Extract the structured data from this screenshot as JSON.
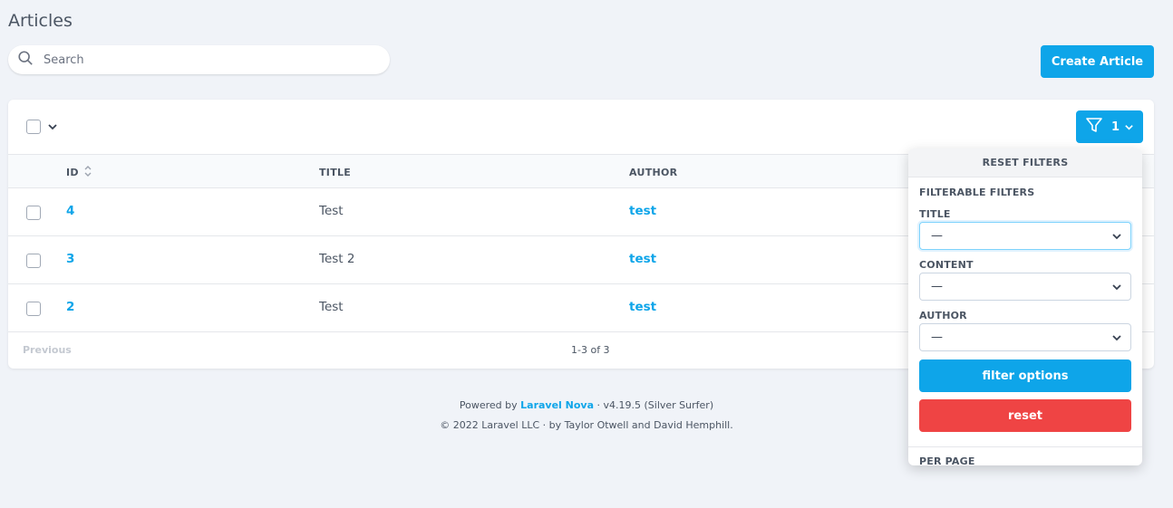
{
  "header": {
    "title": "Articles"
  },
  "search": {
    "placeholder": "Search"
  },
  "actions": {
    "create_label": "Create Article"
  },
  "toolbar": {
    "filter_count": "1"
  },
  "table": {
    "columns": {
      "id": "ID",
      "title": "TITLE",
      "author": "AUTHOR"
    },
    "rows": [
      {
        "id": "4",
        "title": "Test",
        "author": "test"
      },
      {
        "id": "3",
        "title": "Test 2",
        "author": "test"
      },
      {
        "id": "2",
        "title": "Test",
        "author": "test"
      }
    ]
  },
  "pagination": {
    "previous": "Previous",
    "range": "1-3 of 3"
  },
  "footer": {
    "powered_by": "Powered by",
    "brand": "Laravel Nova",
    "version": "· v4.19.5 (Silver Surfer)",
    "copyright": "© 2022 Laravel LLC · by Taylor Otwell and David Hemphill."
  },
  "filter_panel": {
    "reset_header": "RESET FILTERS",
    "section_title": "FILTERABLE FILTERS",
    "filters": [
      {
        "label": "TITLE",
        "value": "—"
      },
      {
        "label": "CONTENT",
        "value": "—"
      },
      {
        "label": "AUTHOR",
        "value": "—"
      }
    ],
    "apply_label": "filter options",
    "reset_label": "reset",
    "per_page_label": "PER PAGE"
  },
  "colors": {
    "accent": "#0ea5e9",
    "danger": "#ef4444",
    "background": "#f0f3f8"
  }
}
